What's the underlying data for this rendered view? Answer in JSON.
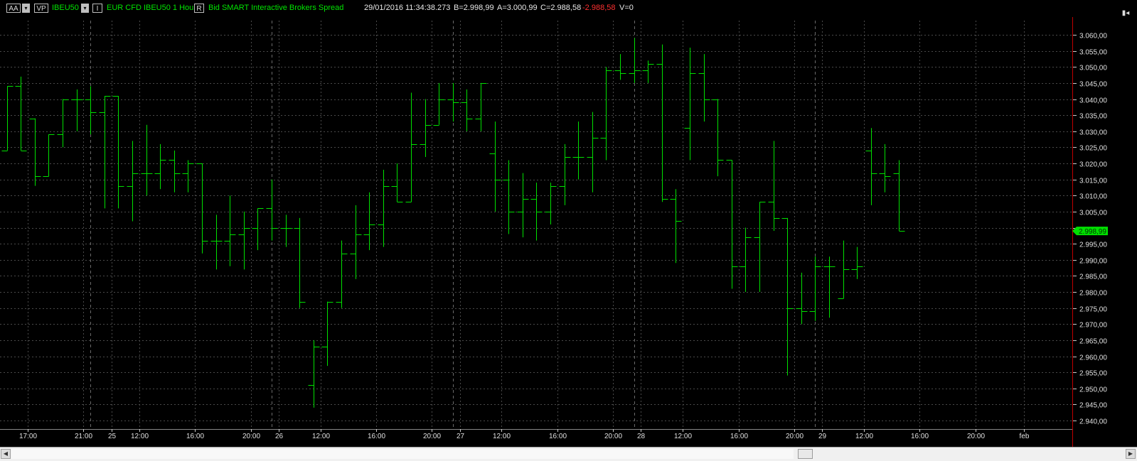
{
  "toolbar": {
    "aa_label": "AA",
    "vp_label": "VP",
    "symbol": "IBEU50",
    "dropdown_glyph": "▾",
    "i_label": "I",
    "description": "EUR CFD IBEU50  1 Hour",
    "r_label": "R",
    "quote_info": "Bid  SMART  Interactive Brokers  Spread",
    "date": "29/01/2016",
    "time": "11:34:38.273",
    "bid": "B=2.998,99",
    "ask": "A=3.000,99",
    "change": "C=2.988,58",
    "change_neg": "-2.988,58",
    "volume": "V=0",
    "expand_icon": "expand-icon"
  },
  "colors": {
    "bars": "#00e000",
    "grid": "#4a4a4a",
    "axis_text": "#e0e0e0",
    "background": "#000000",
    "last_price_label_bg": "#00e000",
    "separator": "#c00000"
  },
  "chart_data": {
    "type": "ohlc",
    "title": "",
    "ylim": [
      2937,
      3064
    ],
    "y_ticks": [
      2940,
      2945,
      2950,
      2955,
      2960,
      2965,
      2970,
      2975,
      2980,
      2985,
      2990,
      2995,
      3000,
      3005,
      3010,
      3015,
      3020,
      3025,
      3030,
      3035,
      3040,
      3045,
      3050,
      3055,
      3060
    ],
    "y_tick_labels": [
      "2.940,00",
      "2.945,00",
      "2.950,00",
      "2.955,00",
      "2.960,00",
      "2.965,00",
      "2.970,00",
      "2.975,00",
      "2.980,00",
      "2.985,00",
      "2.990,00",
      "2.995,00",
      "",
      "3.005,00",
      "3.010,00",
      "3.015,00",
      "3.020,00",
      "3.025,00",
      "3.030,00",
      "3.035,00",
      "3.040,00",
      "3.045,00",
      "3.050,00",
      "3.055,00",
      "3.060,00"
    ],
    "last_price_label": "2.998,99",
    "last_price": 2998.99,
    "x_labels": [
      "17:00",
      "21:00",
      "25",
      "12:00",
      "16:00",
      "20:00",
      "26",
      "12:00",
      "16:00",
      "20:00",
      "27",
      "12:00",
      "16:00",
      "20:00",
      "28",
      "12:00",
      "16:00",
      "20:00",
      "29",
      "12:00",
      "16:00",
      "20:00",
      "feb"
    ],
    "x_label_slots": [
      1.5,
      5.5,
      7.5,
      9.5,
      13.5,
      17.5,
      19.5,
      22.5,
      26.5,
      30.5,
      32.5,
      35.5,
      39.5,
      43.5,
      45.5,
      48.5,
      52.5,
      56.5,
      58.5,
      61.5,
      65.5,
      69.5,
      73.0
    ],
    "day_separator_slots": [
      6.0,
      19.0,
      32.0,
      45.0,
      58.0
    ],
    "bars": [
      {
        "o": 3024,
        "h": 3044,
        "l": 3024,
        "c": 3044
      },
      {
        "o": 3044,
        "h": 3047,
        "l": 3024,
        "c": 3024
      },
      {
        "o": 3034,
        "h": 3034,
        "l": 3013,
        "c": 3016
      },
      {
        "o": 3016,
        "h": 3029,
        "l": 3016,
        "c": 3029
      },
      {
        "o": 3029,
        "h": 3040,
        "l": 3025,
        "c": 3040
      },
      {
        "o": 3040,
        "h": 3043,
        "l": 3030,
        "c": 3040
      },
      {
        "o": 3040,
        "h": 3044,
        "l": 3029,
        "c": 3036
      },
      {
        "o": 3036,
        "h": 3041,
        "l": 3006,
        "c": 3041
      },
      {
        "o": 3041,
        "h": 3041,
        "l": 3006,
        "c": 3013
      },
      {
        "o": 3013,
        "h": 3027,
        "l": 3002,
        "c": 3017
      },
      {
        "o": 3017,
        "h": 3032,
        "l": 3010,
        "c": 3017
      },
      {
        "o": 3017,
        "h": 3026,
        "l": 3012,
        "c": 3021
      },
      {
        "o": 3021,
        "h": 3024,
        "l": 3011,
        "c": 3017
      },
      {
        "o": 3017,
        "h": 3021,
        "l": 3011,
        "c": 3020
      },
      {
        "o": 3020,
        "h": 3020,
        "l": 2992,
        "c": 2996
      },
      {
        "o": 2996,
        "h": 3004,
        "l": 2987,
        "c": 2996
      },
      {
        "o": 2996,
        "h": 3010,
        "l": 2988,
        "c": 2998
      },
      {
        "o": 2998,
        "h": 3005,
        "l": 2987,
        "c": 3000
      },
      {
        "o": 3000,
        "h": 3006,
        "l": 2993,
        "c": 3006
      },
      {
        "o": 3006,
        "h": 3015,
        "l": 2996,
        "c": 3000
      },
      {
        "o": 3000,
        "h": 3004,
        "l": 2994,
        "c": 3000
      },
      {
        "o": 3000,
        "h": 3003,
        "l": 2975,
        "c": 2977
      },
      {
        "o": 2951,
        "h": 2965,
        "l": 2944,
        "c": 2963
      },
      {
        "o": 2963,
        "h": 2977,
        "l": 2957,
        "c": 2977
      },
      {
        "o": 2977,
        "h": 2996,
        "l": 2975,
        "c": 2992
      },
      {
        "o": 2992,
        "h": 3007,
        "l": 2984,
        "c": 2998
      },
      {
        "o": 2998,
        "h": 3011,
        "l": 2993,
        "c": 3001
      },
      {
        "o": 3001,
        "h": 3018,
        "l": 2994,
        "c": 3013
      },
      {
        "o": 3013,
        "h": 3020,
        "l": 3008,
        "c": 3008
      },
      {
        "o": 3008,
        "h": 3042,
        "l": 3008,
        "c": 3026
      },
      {
        "o": 3026,
        "h": 3040,
        "l": 3022,
        "c": 3032
      },
      {
        "o": 3032,
        "h": 3045,
        "l": 3032,
        "c": 3040
      },
      {
        "o": 3040,
        "h": 3045,
        "l": 3033,
        "c": 3039
      },
      {
        "o": 3039,
        "h": 3043,
        "l": 3030,
        "c": 3034
      },
      {
        "o": 3034,
        "h": 3045,
        "l": 3030,
        "c": 3045
      },
      {
        "o": 3023,
        "h": 3033,
        "l": 3005,
        "c": 3015
      },
      {
        "o": 3015,
        "h": 3021,
        "l": 2998,
        "c": 3005
      },
      {
        "o": 3005,
        "h": 3017,
        "l": 2997,
        "c": 3009
      },
      {
        "o": 3009,
        "h": 3014,
        "l": 2996,
        "c": 3005
      },
      {
        "o": 3005,
        "h": 3014,
        "l": 3001,
        "c": 3013
      },
      {
        "o": 3013,
        "h": 3026,
        "l": 3007,
        "c": 3022
      },
      {
        "o": 3022,
        "h": 3033,
        "l": 3015,
        "c": 3022
      },
      {
        "o": 3022,
        "h": 3036,
        "l": 3011,
        "c": 3028
      },
      {
        "o": 3028,
        "h": 3050,
        "l": 3021,
        "c": 3049
      },
      {
        "o": 3049,
        "h": 3054,
        "l": 3046,
        "c": 3048
      },
      {
        "o": 3048,
        "h": 3059,
        "l": 3045,
        "c": 3049
      },
      {
        "o": 3049,
        "h": 3052,
        "l": 3045,
        "c": 3051
      },
      {
        "o": 3051,
        "h": 3057,
        "l": 3008,
        "c": 3009
      },
      {
        "o": 3009,
        "h": 3012,
        "l": 2989,
        "c": 3002
      },
      {
        "o": 3031,
        "h": 3056,
        "l": 3021,
        "c": 3048
      },
      {
        "o": 3048,
        "h": 3054,
        "l": 3033,
        "c": 3040
      },
      {
        "o": 3040,
        "h": 3040,
        "l": 3016,
        "c": 3021
      },
      {
        "o": 3021,
        "h": 3021,
        "l": 2981,
        "c": 2988
      },
      {
        "o": 2988,
        "h": 3000,
        "l": 2980,
        "c": 2997
      },
      {
        "o": 2997,
        "h": 3008,
        "l": 2980,
        "c": 3008
      },
      {
        "o": 3008,
        "h": 3027,
        "l": 2999,
        "c": 3003
      },
      {
        "o": 3003,
        "h": 3003,
        "l": 2954,
        "c": 2975
      },
      {
        "o": 2975,
        "h": 2986,
        "l": 2970,
        "c": 2974
      },
      {
        "o": 2974,
        "h": 2991,
        "l": 2971,
        "c": 2988
      },
      {
        "o": 2988,
        "h": 2991,
        "l": 2972,
        "c": 2988
      },
      {
        "o": 2978,
        "h": 2996,
        "l": 2978,
        "c": 2987
      },
      {
        "o": 2987,
        "h": 2994,
        "l": 2984,
        "c": 2988
      },
      {
        "o": 3024,
        "h": 3031,
        "l": 3007,
        "c": 3017
      },
      {
        "o": 3017,
        "h": 3026,
        "l": 3011,
        "c": 3016
      },
      {
        "o": 3017,
        "h": 3021,
        "l": 2999,
        "c": 2999
      }
    ]
  }
}
